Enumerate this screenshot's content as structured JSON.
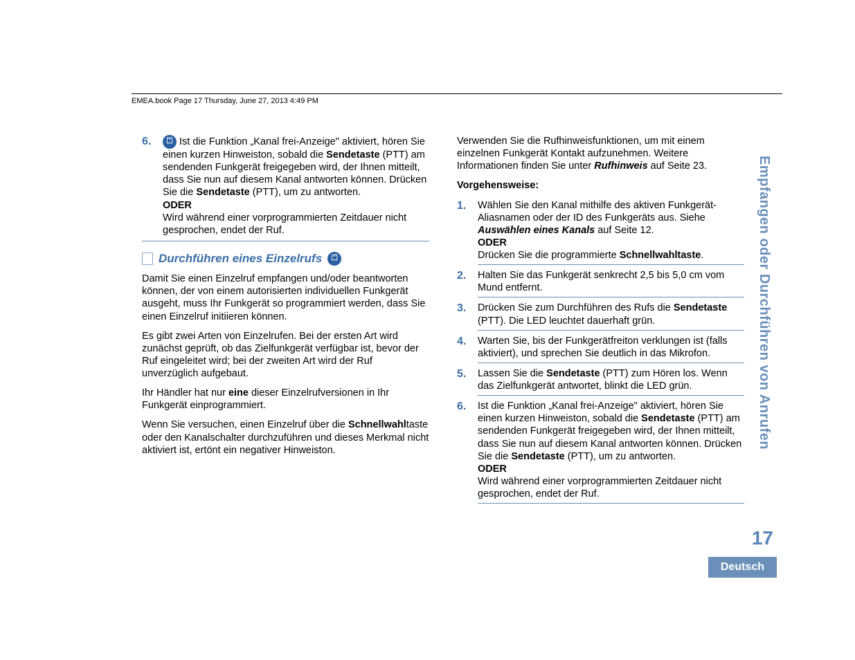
{
  "header": "EMEA.book  Page 17  Thursday, June 27, 2013  4:49 PM",
  "sidebar_title": "Empfangen oder Durchführen von Anrufen",
  "page_number": "17",
  "language": "Deutsch",
  "left": {
    "step6_num": "6.",
    "step6_a": " Ist die Funktion „Kanal frei-Anzeige\" aktiviert, hören Sie einen kurzen Hinweiston, sobald die ",
    "step6_b": "Sendetaste",
    "step6_c": " (PTT) am sendenden Funkgerät freigegeben wird, der Ihnen mitteilt, dass Sie nun auf diesem Kanal antworten können. Drücken Sie die ",
    "step6_d": "Sendetaste",
    "step6_e": " (PTT), um zu antworten.",
    "oder": "ODER",
    "step6_f": "Wird während einer vorprogrammierten Zeitdauer nicht gesprochen, endet der Ruf.",
    "heading": "Durchführen eines Einzelrufs",
    "p1": "Damit Sie einen Einzelruf empfangen und/oder beantworten können, der von einem autorisierten individuellen Funkgerät ausgeht, muss Ihr Funkgerät so programmiert werden, dass Sie einen Einzelruf initiieren können.",
    "p2": "Es gibt zwei Arten von Einzelrufen. Bei der ersten Art wird zunächst geprüft, ob das Zielfunkgerät verfügbar ist, bevor der Ruf eingeleitet wird; bei der zweiten Art wird der Ruf unverzüglich aufgebaut.",
    "p3_a": "Ihr Händler hat nur ",
    "p3_b": "eine",
    "p3_c": " dieser Einzelrufversionen in Ihr Funkgerät einprogrammiert.",
    "p4_a": "Wenn Sie versuchen, einen Einzelruf über die ",
    "p4_b": "Schnellwahl",
    "p4_c": "taste oder den Kanalschalter durchzuführen und dieses Merkmal nicht aktiviert ist, ertönt ein negativer Hinweiston."
  },
  "right": {
    "intro_a": "Verwenden Sie die Rufhinweisfunktionen, um mit einem einzelnen Funkgerät Kontakt aufzunehmen. Weitere Informationen finden Sie unter ",
    "intro_b": "Rufhinweis",
    "intro_c": " auf Seite 23.",
    "proc": "Vorgehensweise:",
    "s1_num": "1.",
    "s1_a": "Wählen Sie den Kanal mithilfe des aktiven Funkgerät-Aliasnamen oder der ID des Funkgeräts aus. Siehe ",
    "s1_b": "Auswählen eines Kanals",
    "s1_c": " auf Seite 12.",
    "oder": "ODER",
    "s1_d": "Drücken Sie die programmierte ",
    "s1_e": "Schnellwahltaste",
    "s1_f": ".",
    "s2_num": "2.",
    "s2": "Halten Sie das Funkgerät senkrecht 2,5 bis 5,0 cm vom Mund entfernt.",
    "s3_num": "3.",
    "s3_a": "Drücken Sie zum Durchführen des Rufs die ",
    "s3_b": "Sendetaste",
    "s3_c": " (PTT). Die LED leuchtet dauerhaft grün.",
    "s4_num": "4.",
    "s4": "Warten Sie, bis der Funkgerätfreiton verklungen ist (falls aktiviert), und sprechen Sie deutlich in das Mikrofon.",
    "s5_num": "5.",
    "s5_a": "Lassen Sie die ",
    "s5_b": "Sendetaste",
    "s5_c": " (PTT) zum Hören los. Wenn das Zielfunkgerät antwortet, blinkt die LED grün.",
    "s6_num": "6.",
    "s6_a": "Ist die Funktion „Kanal frei-Anzeige\" aktiviert, hören Sie einen kurzen Hinweiston, sobald die ",
    "s6_b": "Sendetaste",
    "s6_c": " (PTT) am sendenden Funkgerät freigegeben wird, der Ihnen mitteilt, dass Sie nun auf diesem Kanal antworten können. Drücken Sie die ",
    "s6_d": "Sendetaste",
    "s6_e": " (PTT), um zu antworten.",
    "s6_f": "Wird während einer vorprogrammierten Zeitdauer nicht gesprochen, endet der Ruf."
  }
}
